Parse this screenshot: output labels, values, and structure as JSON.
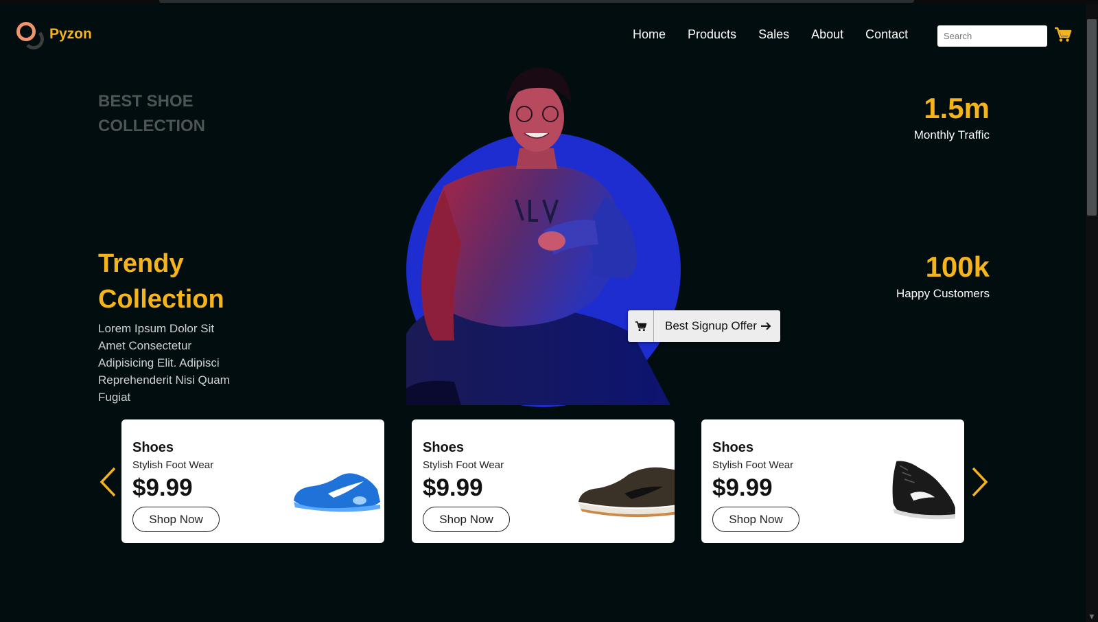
{
  "brand": {
    "name": "Pyzon",
    "accent": "#f5b31c",
    "ring_color": "#f0946b"
  },
  "nav": {
    "items": [
      "Home",
      "Products",
      "Sales",
      "About",
      "Contact"
    ]
  },
  "search": {
    "placeholder": "Search"
  },
  "hero": {
    "kicker": "BEST SHOE COLLECTION",
    "headline": "Trendy Collection",
    "description": "Lorem Ipsum Dolor Sit Amet Consectetur Adipisicing Elit. Adipisci Reprehenderit Nisi Quam Fugiat",
    "offer_label": "Best Signup Offer",
    "circle_color": "#1d2dcf"
  },
  "stats": [
    {
      "value": "1.5m",
      "label": "Monthly Traffic"
    },
    {
      "value": "100k",
      "label": "Happy Customers"
    }
  ],
  "products": [
    {
      "title": "Shoes",
      "subtitle": "Stylish Foot Wear",
      "price": "$9.99",
      "button": "Shop Now",
      "shoe": "blue-running-shoe"
    },
    {
      "title": "Shoes",
      "subtitle": "Stylish Foot Wear",
      "price": "$9.99",
      "button": "Shop Now",
      "shoe": "brown-suede-shoe"
    },
    {
      "title": "Shoes",
      "subtitle": "Stylish Foot Wear",
      "price": "$9.99",
      "button": "Shop Now",
      "shoe": "black-high-top-shoe"
    }
  ],
  "icons": {
    "cart": "shopping-cart-icon",
    "prev": "chevron-left-icon",
    "next": "chevron-right-icon",
    "arrow": "arrow-right-icon"
  }
}
